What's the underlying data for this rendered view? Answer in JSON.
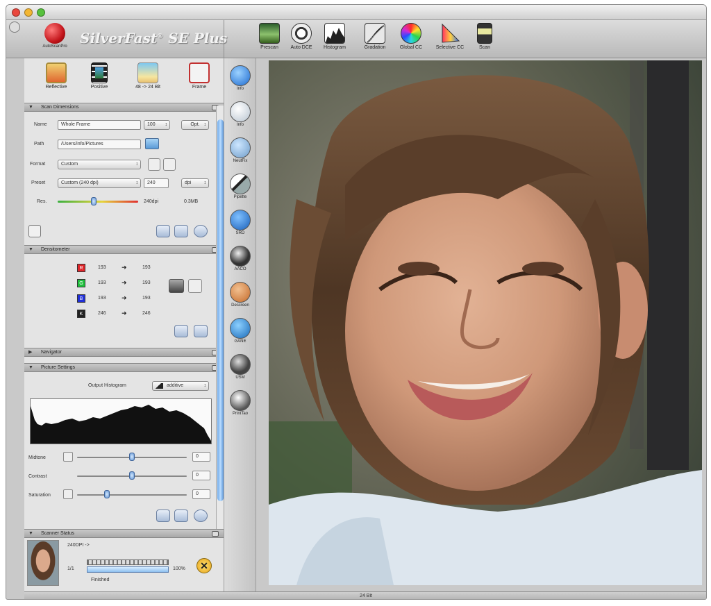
{
  "app": {
    "logo_text": "AutoScanPro",
    "brand": "SilverFast",
    "brand_sup": "®",
    "brand_edition": "SE Plus"
  },
  "toolbar": [
    {
      "label": "Prescan",
      "icon": "prescan-icon"
    },
    {
      "label": "Auto DCE",
      "icon": "auto-dce-icon"
    },
    {
      "label": "Histogram",
      "icon": "histogram-icon"
    },
    {
      "label": "Gradation",
      "icon": "gradation-icon"
    },
    {
      "label": "Global CC",
      "icon": "global-cc-icon"
    },
    {
      "label": "Selective CC",
      "icon": "selective-cc-icon"
    },
    {
      "label": "Scan",
      "icon": "scan-icon"
    }
  ],
  "modes": [
    {
      "label": "Reflective",
      "icon": "reflective-icon"
    },
    {
      "label": "Positive",
      "icon": "positive-film-icon"
    },
    {
      "label": "48 -> 24 Bit",
      "icon": "bit-depth-icon"
    },
    {
      "label": "Frame",
      "icon": "frame-icon"
    }
  ],
  "scan_dimensions": {
    "title": "Scan Dimensions",
    "name_label": "Name",
    "name_value": "Whole Frame",
    "name_num": "100",
    "opt_label": "Opt.",
    "path_label": "Path",
    "path_value": "/Users/info/Pictures",
    "format_label": "Format",
    "format_value": "Custom",
    "preset_label": "Preset",
    "preset_value": "Custom (240 dpi)",
    "preset_num": "240",
    "unit_value": "dpi",
    "res_label": "Res.",
    "res_value": "240dpi",
    "res_size": "0.3MB",
    "res_fraction": 0.45
  },
  "densitometer": {
    "title": "Densitometer",
    "rows": [
      {
        "ch": "R",
        "from": "193",
        "to": "193",
        "color": "#e0262a"
      },
      {
        "ch": "G",
        "from": "193",
        "to": "193",
        "color": "#1fbf3c"
      },
      {
        "ch": "B",
        "from": "193",
        "to": "193",
        "color": "#2130d8"
      },
      {
        "ch": "K",
        "from": "246",
        "to": "246",
        "color": "#222222"
      }
    ]
  },
  "navigator": {
    "title": "Navigator"
  },
  "picture_settings": {
    "title": "Picture Settings",
    "output_hist_label": "Output Histogram",
    "output_hist_value": "additive",
    "midtone_label": "Midtone",
    "midtone_value": "0",
    "midtone_fraction": 0.5,
    "contrast_label": "Contrast",
    "contrast_value": "0",
    "contrast_fraction": 0.5,
    "saturation_label": "Saturation",
    "saturation_value": "0",
    "saturation_fraction": 0.27
  },
  "scanner_status": {
    "title": "Scanner Status",
    "dpi_text": "240DPI ->",
    "count": "1/1",
    "percent": "100%",
    "state": "Finished",
    "progress_fraction": 1.0
  },
  "tools": [
    {
      "label": "Info",
      "icon": "info-icon"
    },
    {
      "label": "Info",
      "icon": "pipette-info-icon"
    },
    {
      "label": "NeutFix",
      "icon": "neutral-fix-icon"
    },
    {
      "label": "Pipette",
      "icon": "pipette-icon"
    },
    {
      "label": "SRD",
      "icon": "srd-icon"
    },
    {
      "label": "AACO",
      "icon": "aaco-icon"
    },
    {
      "label": "Descreen",
      "icon": "descreen-icon"
    },
    {
      "label": "GANE",
      "icon": "gane-icon"
    },
    {
      "label": "USM",
      "icon": "usm-icon"
    },
    {
      "label": "PrintTao",
      "icon": "printtao-icon"
    }
  ],
  "status_bar": {
    "text": "24 Bit"
  }
}
